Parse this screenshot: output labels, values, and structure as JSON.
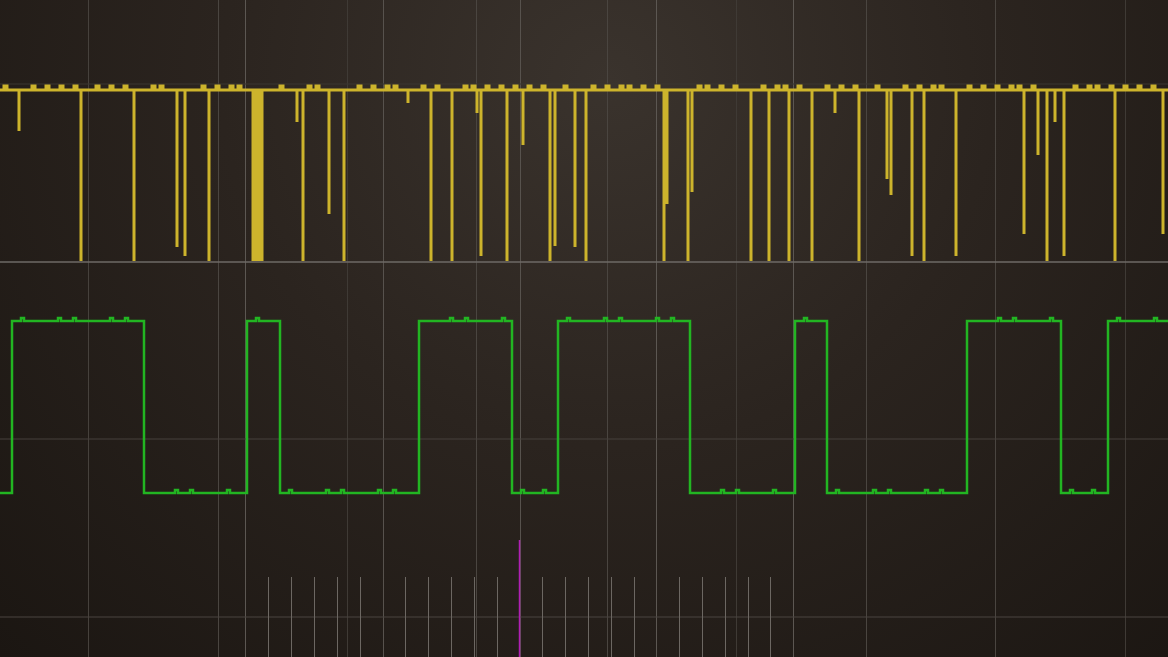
{
  "scope": {
    "traces": [
      {
        "kind": "pulse-train",
        "color": "#cdb42c"
      },
      {
        "kind": "square-wave",
        "color": "#22b522"
      }
    ]
  }
}
